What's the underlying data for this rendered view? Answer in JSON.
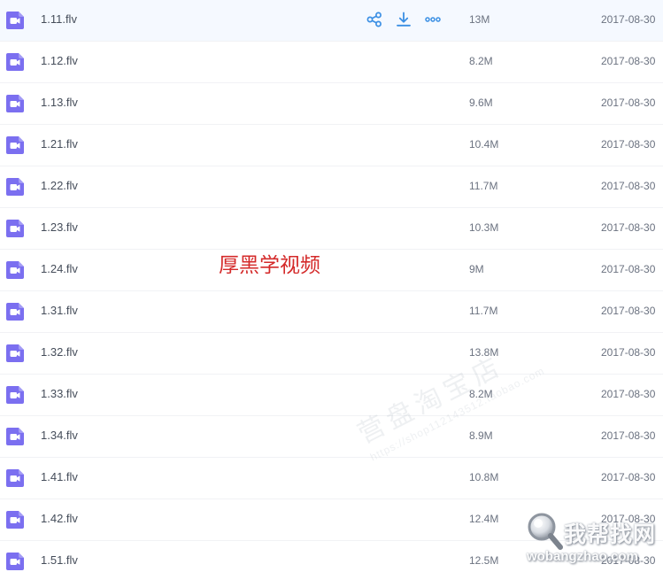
{
  "files": [
    {
      "name": "1.11.flv",
      "size": "13M",
      "date": "2017-08-30",
      "hovered": true
    },
    {
      "name": "1.12.flv",
      "size": "8.2M",
      "date": "2017-08-30"
    },
    {
      "name": "1.13.flv",
      "size": "9.6M",
      "date": "2017-08-30"
    },
    {
      "name": "1.21.flv",
      "size": "10.4M",
      "date": "2017-08-30"
    },
    {
      "name": "1.22.flv",
      "size": "11.7M",
      "date": "2017-08-30"
    },
    {
      "name": "1.23.flv",
      "size": "10.3M",
      "date": "2017-08-30"
    },
    {
      "name": "1.24.flv",
      "size": "9M",
      "date": "2017-08-30"
    },
    {
      "name": "1.31.flv",
      "size": "11.7M",
      "date": "2017-08-30"
    },
    {
      "name": "1.32.flv",
      "size": "13.8M",
      "date": "2017-08-30"
    },
    {
      "name": "1.33.flv",
      "size": "8.2M",
      "date": "2017-08-30"
    },
    {
      "name": "1.34.flv",
      "size": "8.9M",
      "date": "2017-08-30"
    },
    {
      "name": "1.41.flv",
      "size": "10.8M",
      "date": "2017-08-30"
    },
    {
      "name": "1.42.flv",
      "size": "12.4M",
      "date": "2017-08-30"
    },
    {
      "name": "1.51.flv",
      "size": "12.5M",
      "date": "2017-08-30"
    }
  ],
  "row_actions": [
    {
      "name": "share-icon"
    },
    {
      "name": "download-icon"
    },
    {
      "name": "more-icon"
    }
  ],
  "icons": {
    "file": "video-file-icon"
  },
  "overlay": {
    "text": "厚黑学视频"
  },
  "watermark": {
    "line1": "营盘淘宝店",
    "line2": "https://shop112143512.taobao.com"
  },
  "logo": {
    "name": "我帮找网",
    "domain": "wobangzhao.com"
  },
  "colors": {
    "file_icon": "#7b6ff0",
    "action_icon": "#3b8fe4",
    "text_primary": "#454d5a",
    "text_secondary": "#6b7280",
    "overlay_text": "#d42a2a",
    "hover_row": "#f5f9ff"
  }
}
